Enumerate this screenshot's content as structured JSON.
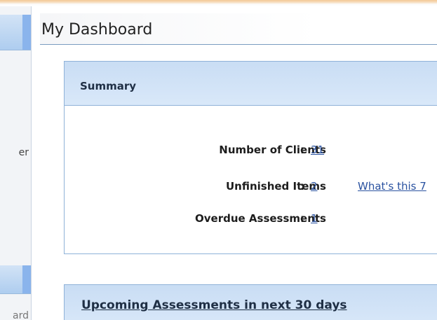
{
  "page_title": "My Dashboard",
  "sidebar": {
    "partial_labels": [
      "er",
      "",
      "ard"
    ]
  },
  "summary": {
    "title": "Summary",
    "stats": [
      {
        "label": "Number of Clients",
        "value": "31"
      },
      {
        "label": "Unfinished Items",
        "value": "2"
      },
      {
        "label": "Overdue Assessments",
        "value": "1"
      }
    ],
    "help_link": "What's this 7",
    "separator": ":"
  },
  "upcoming": {
    "title": "Upcoming Assessments in next 30 days"
  },
  "colors": {
    "panel_header": "#c9ddf4",
    "panel_border": "#8fb2d8",
    "link": "#2a52a0",
    "nav_accent": "#8ab4ec",
    "top_accent": "#f3c995"
  }
}
